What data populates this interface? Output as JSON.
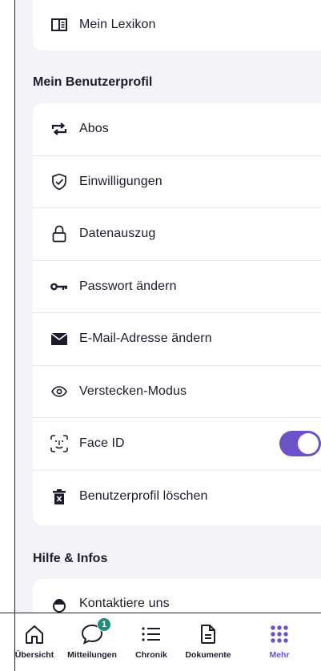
{
  "lexikon": {
    "label": "Mein Lexikon"
  },
  "profile_section": {
    "title": "Mein Benutzerprofil",
    "items": [
      {
        "label": "Abos",
        "icon": "repeat-icon"
      },
      {
        "label": "Einwilligungen",
        "icon": "shield-check-icon"
      },
      {
        "label": "Datenauszug",
        "icon": "lock-icon"
      },
      {
        "label": "Passwort ändern",
        "icon": "key-icon"
      },
      {
        "label": "E-Mail-Adresse ändern",
        "icon": "envelope-icon"
      },
      {
        "label": "Verstecken-Modus",
        "icon": "eye-icon"
      },
      {
        "label": "Face ID",
        "icon": "face-id-icon",
        "toggle_on": true
      },
      {
        "label": "Benutzerprofil löschen",
        "icon": "trash-icon"
      }
    ]
  },
  "help_section": {
    "title": "Hilfe & Infos",
    "items": [
      {
        "label": "Kontaktiere uns",
        "icon": "support-icon"
      }
    ]
  },
  "tabbar": {
    "tabs": [
      {
        "label": "Übersicht",
        "icon": "home-icon"
      },
      {
        "label": "Mitteilungen",
        "icon": "chat-icon",
        "badge": "1"
      },
      {
        "label": "Chronik",
        "icon": "list-icon"
      },
      {
        "label": "Dokumente",
        "icon": "document-icon"
      },
      {
        "label": "Mehr",
        "icon": "grid-dots-icon",
        "active": true
      }
    ]
  },
  "colors": {
    "accent": "#6b52c8",
    "badge": "#1f8f7d",
    "background": "#f4f4f8"
  }
}
